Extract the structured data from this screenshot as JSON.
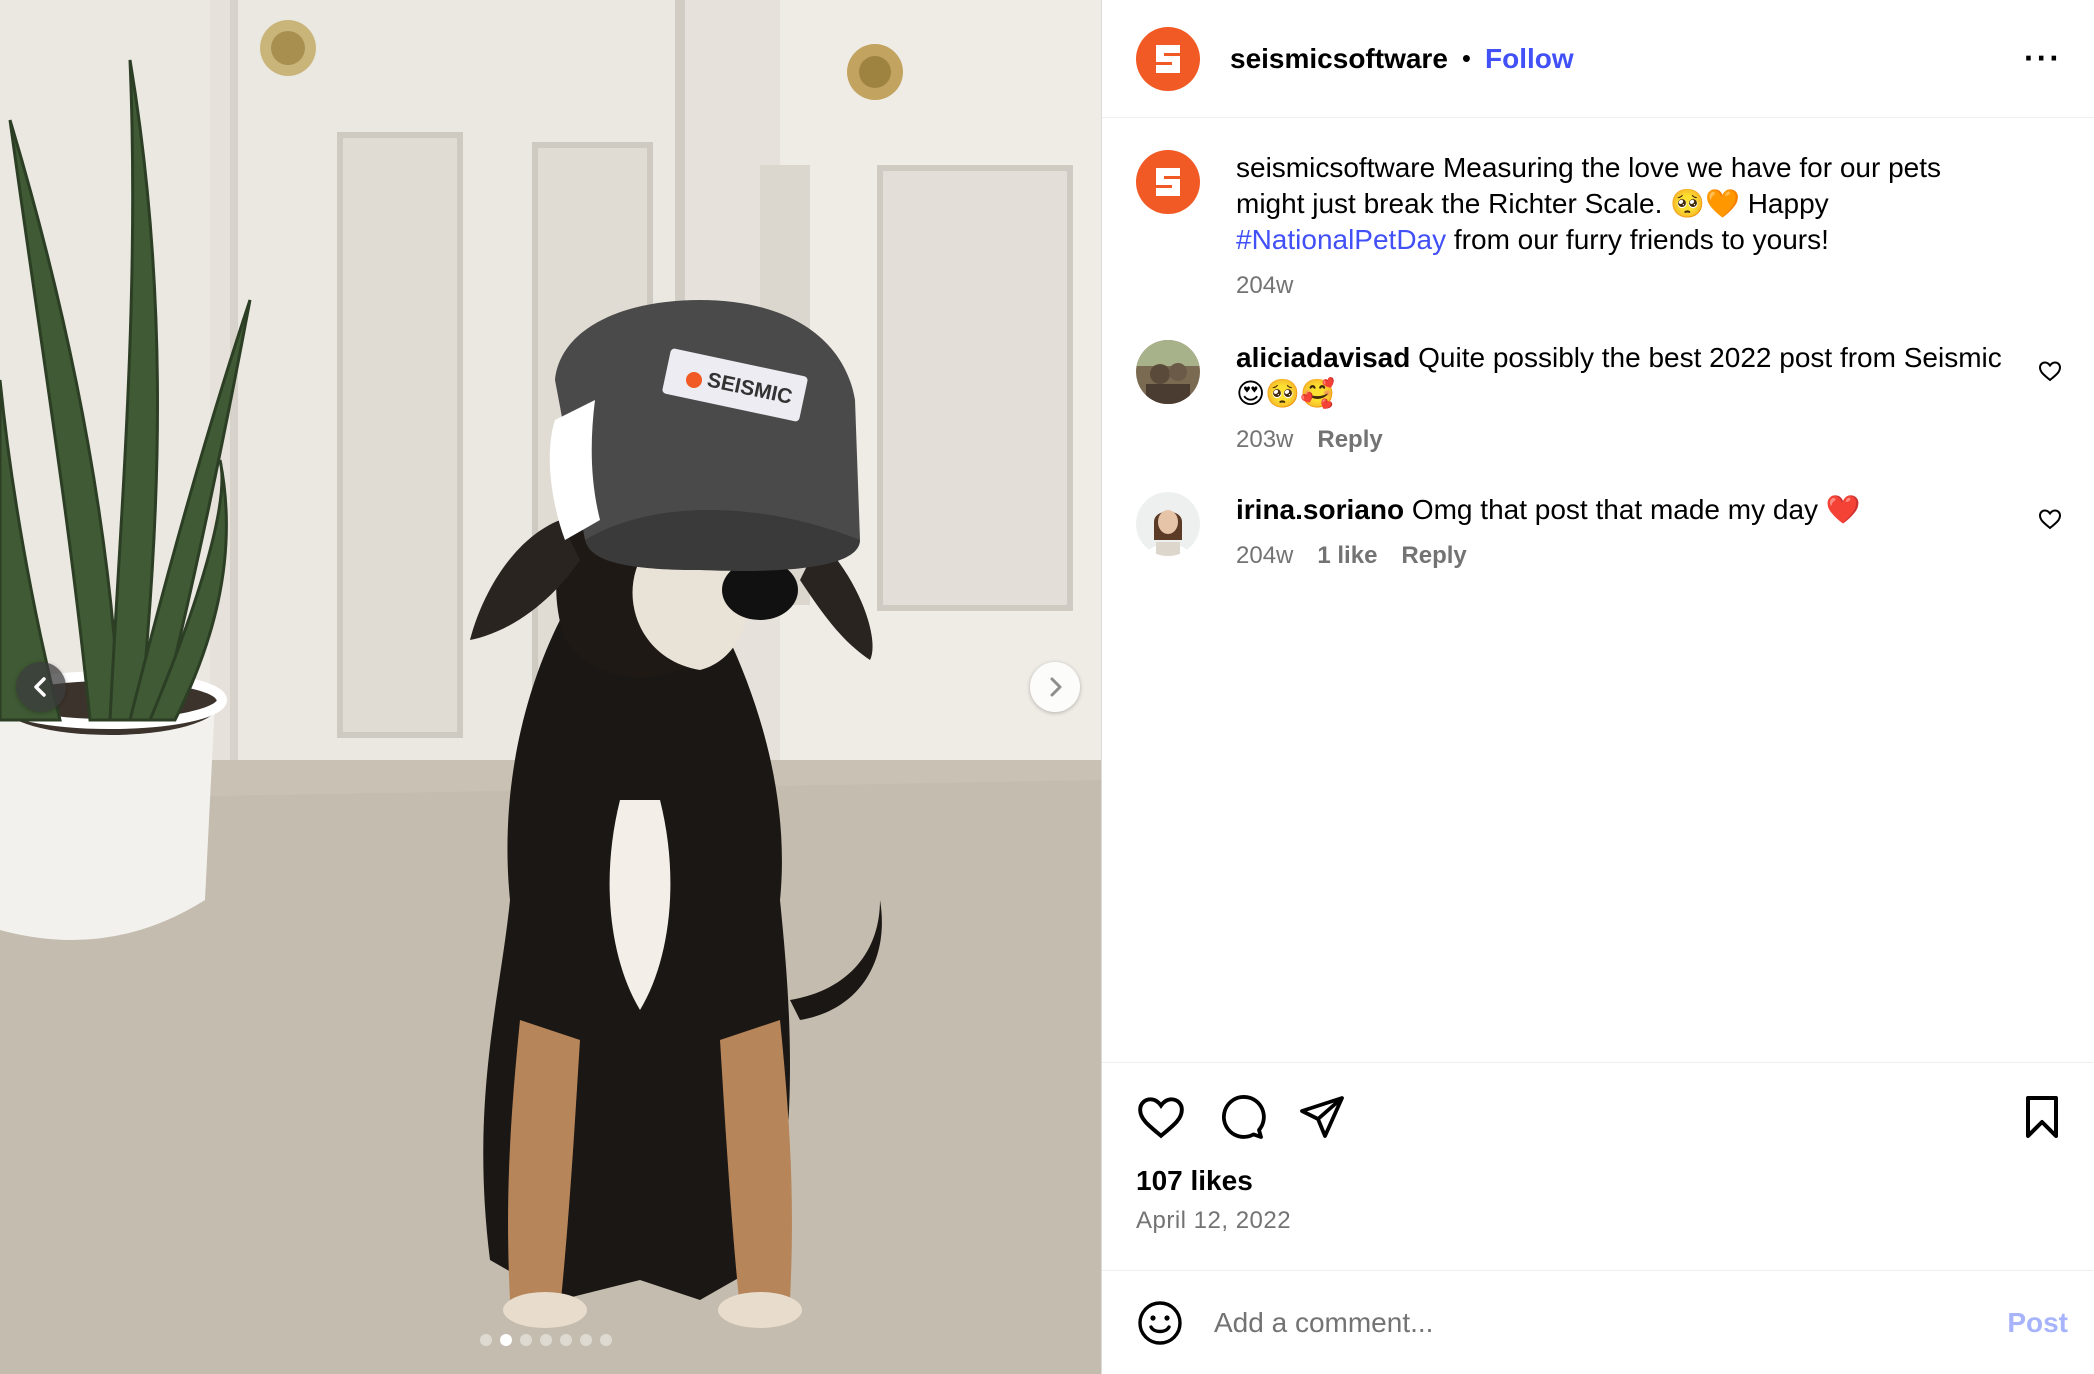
{
  "media": {
    "cap_logo_text": "SEISMIC",
    "carousel_total": 7,
    "carousel_active_index": 1,
    "prev_icon": "chevron-left-icon",
    "next_icon": "chevron-right-icon"
  },
  "header": {
    "username": "seismicsoftware",
    "separator": "•",
    "follow_label": "Follow",
    "more_label": "···",
    "brand_color": "#f15a24",
    "link_color": "#4150f7"
  },
  "caption": {
    "username": "seismicsoftware",
    "text_before": "Measuring the love we have for our pets might just break the Richter Scale. 🥺🧡 Happy ",
    "hashtag": "#NationalPetDay",
    "text_after": " from our furry friends to yours!",
    "time": "204w"
  },
  "comments": [
    {
      "username": "aliciadavisad",
      "text": "Quite possibly the best 2022 post from Seismic 😍🥺🥰",
      "time": "203w",
      "reply_label": "Reply"
    },
    {
      "username": "irina.soriano",
      "text": "Omg that post that made my day ❤️",
      "time": "204w",
      "likes_label": "1 like",
      "reply_label": "Reply"
    }
  ],
  "actions": {
    "like_icon": "heart-icon",
    "comment_icon": "comment-icon",
    "share_icon": "send-icon",
    "save_icon": "bookmark-icon",
    "likes": "107 likes",
    "date": "April 12, 2022"
  },
  "add_comment": {
    "placeholder": "Add a comment...",
    "post_label": "Post"
  }
}
